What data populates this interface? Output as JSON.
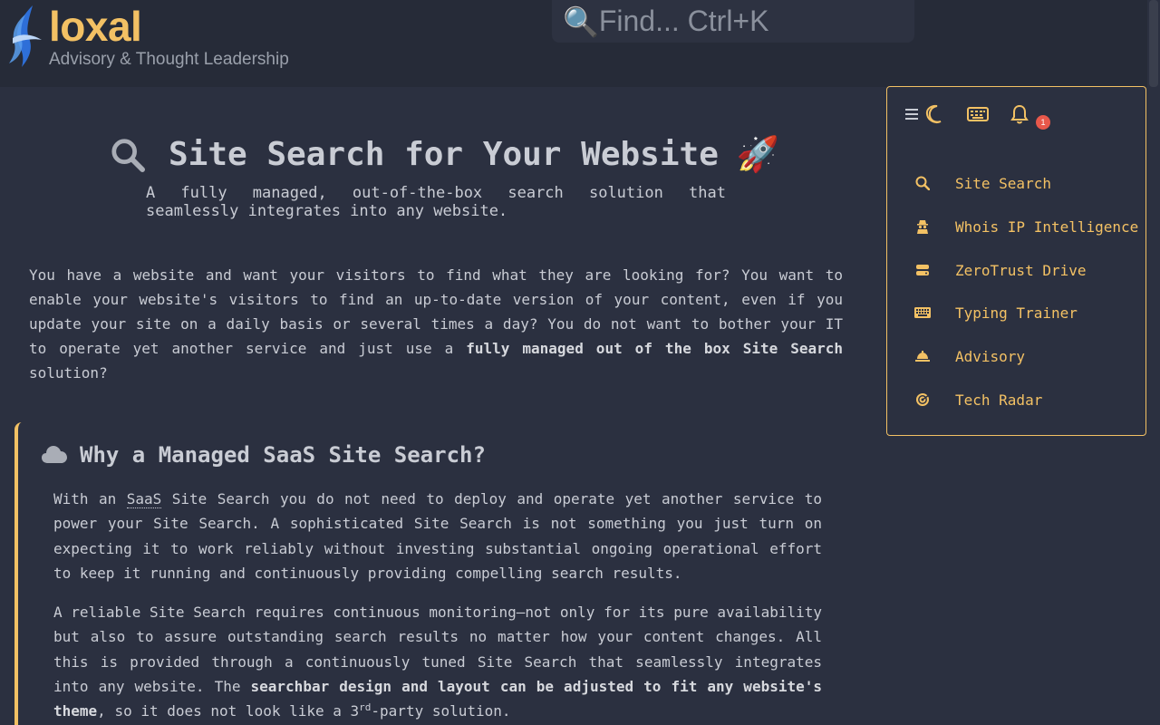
{
  "header": {
    "brand": "loxal",
    "tagline": "Advisory & Thought Leadership",
    "search_placeholder": "Find... Ctrl+K"
  },
  "hero": {
    "title": "Site Search for Your Website",
    "subtitle": "A fully managed, out-of-the-box search solution that seamlessly integrates into any website."
  },
  "intro": {
    "text": "You have a website and want your visitors to find what they are looking for? You want to enable your website's visitors to find an up-to-date version of your content, even if you update your site on a daily basis or several times a day? You do not want to bother your IT to operate yet another service and just use a ",
    "bold": "fully managed out of the box Site Search",
    "tail": " solution?"
  },
  "why": {
    "title": "Why a Managed SaaS Site Search?",
    "p1_pre": "With an ",
    "p1_abbr": "SaaS",
    "p1_post": " Site Search you do not need to deploy and operate yet another service to power your Site Search. A sophisticated Site Search is not something you just turn on expecting it to work reliably without investing substantial ongoing operational effort to keep it running and continuously providing compelling search results.",
    "p2_pre": "A reliable Site Search requires continuous monitoring—not only for its pure availability but also to assure outstanding search results no matter how your content changes. All this is provided through a continuously tuned Site Search that seamlessly integrates into any website. The ",
    "p2_bold": "searchbar design and layout can be adjusted to fit any website's theme",
    "p2_mid": ", so it does not look like a 3",
    "p2_sup": "rd",
    "p2_post": "-party solution."
  },
  "menu": {
    "notification_count": "1",
    "items": [
      {
        "label": "Site Search",
        "icon": "search-icon"
      },
      {
        "label": "Whois IP Intelligence",
        "icon": "spy-icon"
      },
      {
        "label": "ZeroTrust Drive",
        "icon": "drive-icon"
      },
      {
        "label": "Typing Trainer",
        "icon": "keyboard-icon"
      },
      {
        "label": "Advisory",
        "icon": "bell-concierge-icon"
      },
      {
        "label": "Tech Radar",
        "icon": "radar-icon"
      }
    ]
  },
  "colors": {
    "accent": "#f3c164",
    "background": "#2b3040",
    "text": "#c9ccd4",
    "badge": "#e8584b"
  }
}
